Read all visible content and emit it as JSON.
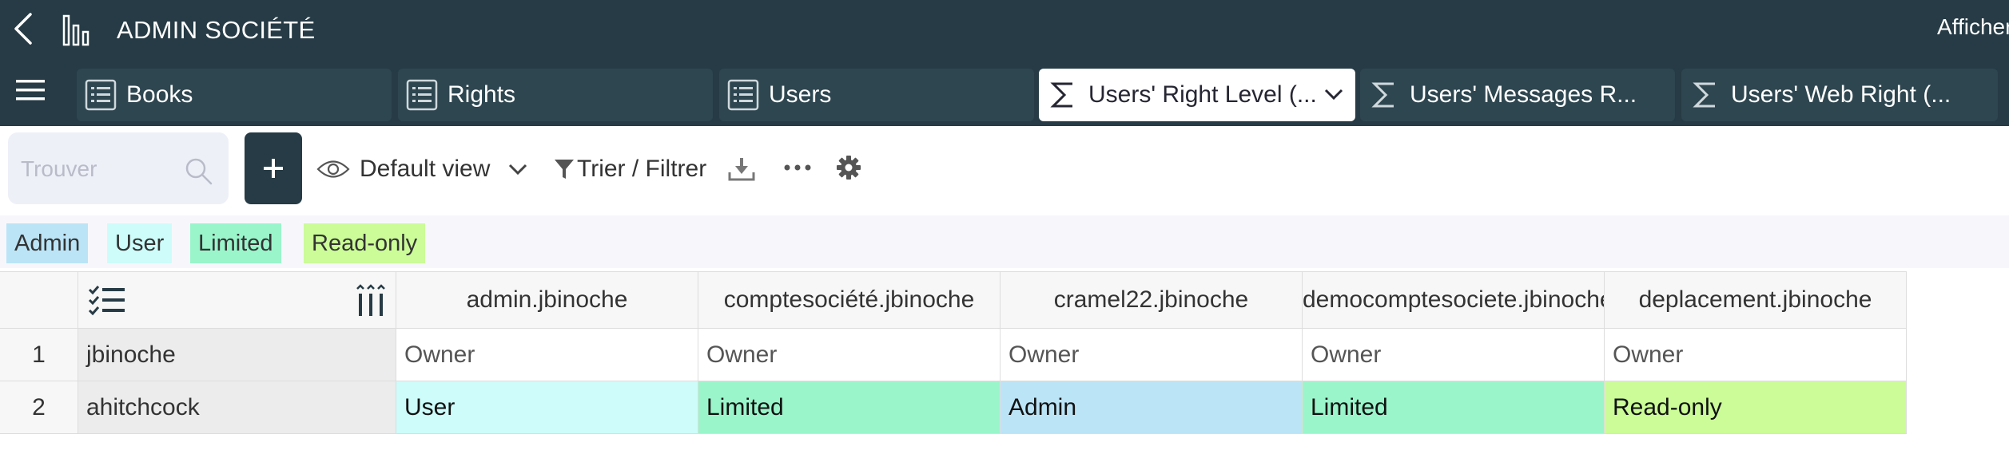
{
  "topbar": {
    "title": "ADMIN SOCIÉTÉ",
    "right_link": "Afficher"
  },
  "tabs": [
    {
      "label": "Books",
      "icon": "list-icon",
      "active": false
    },
    {
      "label": "Rights",
      "icon": "list-icon",
      "active": false
    },
    {
      "label": "Users",
      "icon": "list-icon",
      "active": false
    },
    {
      "label": "Users' Right Level (...",
      "icon": "sigma-icon",
      "active": true
    },
    {
      "label": "Users' Messages R...",
      "icon": "sigma-icon",
      "active": false
    },
    {
      "label": "Users' Web Right (...",
      "icon": "sigma-icon",
      "active": false
    }
  ],
  "toolbar": {
    "search_placeholder": "Trouver",
    "add_label": "+",
    "view_label": "Default view",
    "filter_label": "Trier / Filtrer"
  },
  "choices": [
    {
      "label": "Admin",
      "color": "#bbe4f6"
    },
    {
      "label": "User",
      "color": "#cdfcfa"
    },
    {
      "label": "Limited",
      "color": "#9af5cb"
    },
    {
      "label": "Read-only",
      "color": "#cbfc98"
    }
  ],
  "grid": {
    "columns": [
      "admin.jbinoche",
      "comptesociété.jbinoche",
      "cramel22.jbinoche",
      "democomptesociete.jbinoche",
      "deplacement.jbinoche"
    ],
    "rows": [
      {
        "num": "1",
        "name": "jbinoche",
        "values": [
          "Owner",
          "Owner",
          "Owner",
          "Owner",
          "Owner"
        ]
      },
      {
        "num": "2",
        "name": "ahitchcock",
        "values": [
          "User",
          "Limited",
          "Admin",
          "Limited",
          "Read-only"
        ]
      }
    ]
  },
  "colors": {
    "header_bg": "#263b45",
    "admin": "#bbe4f6",
    "user": "#cdfcfa",
    "limited": "#9af5cb",
    "read_only": "#cbfc98"
  }
}
